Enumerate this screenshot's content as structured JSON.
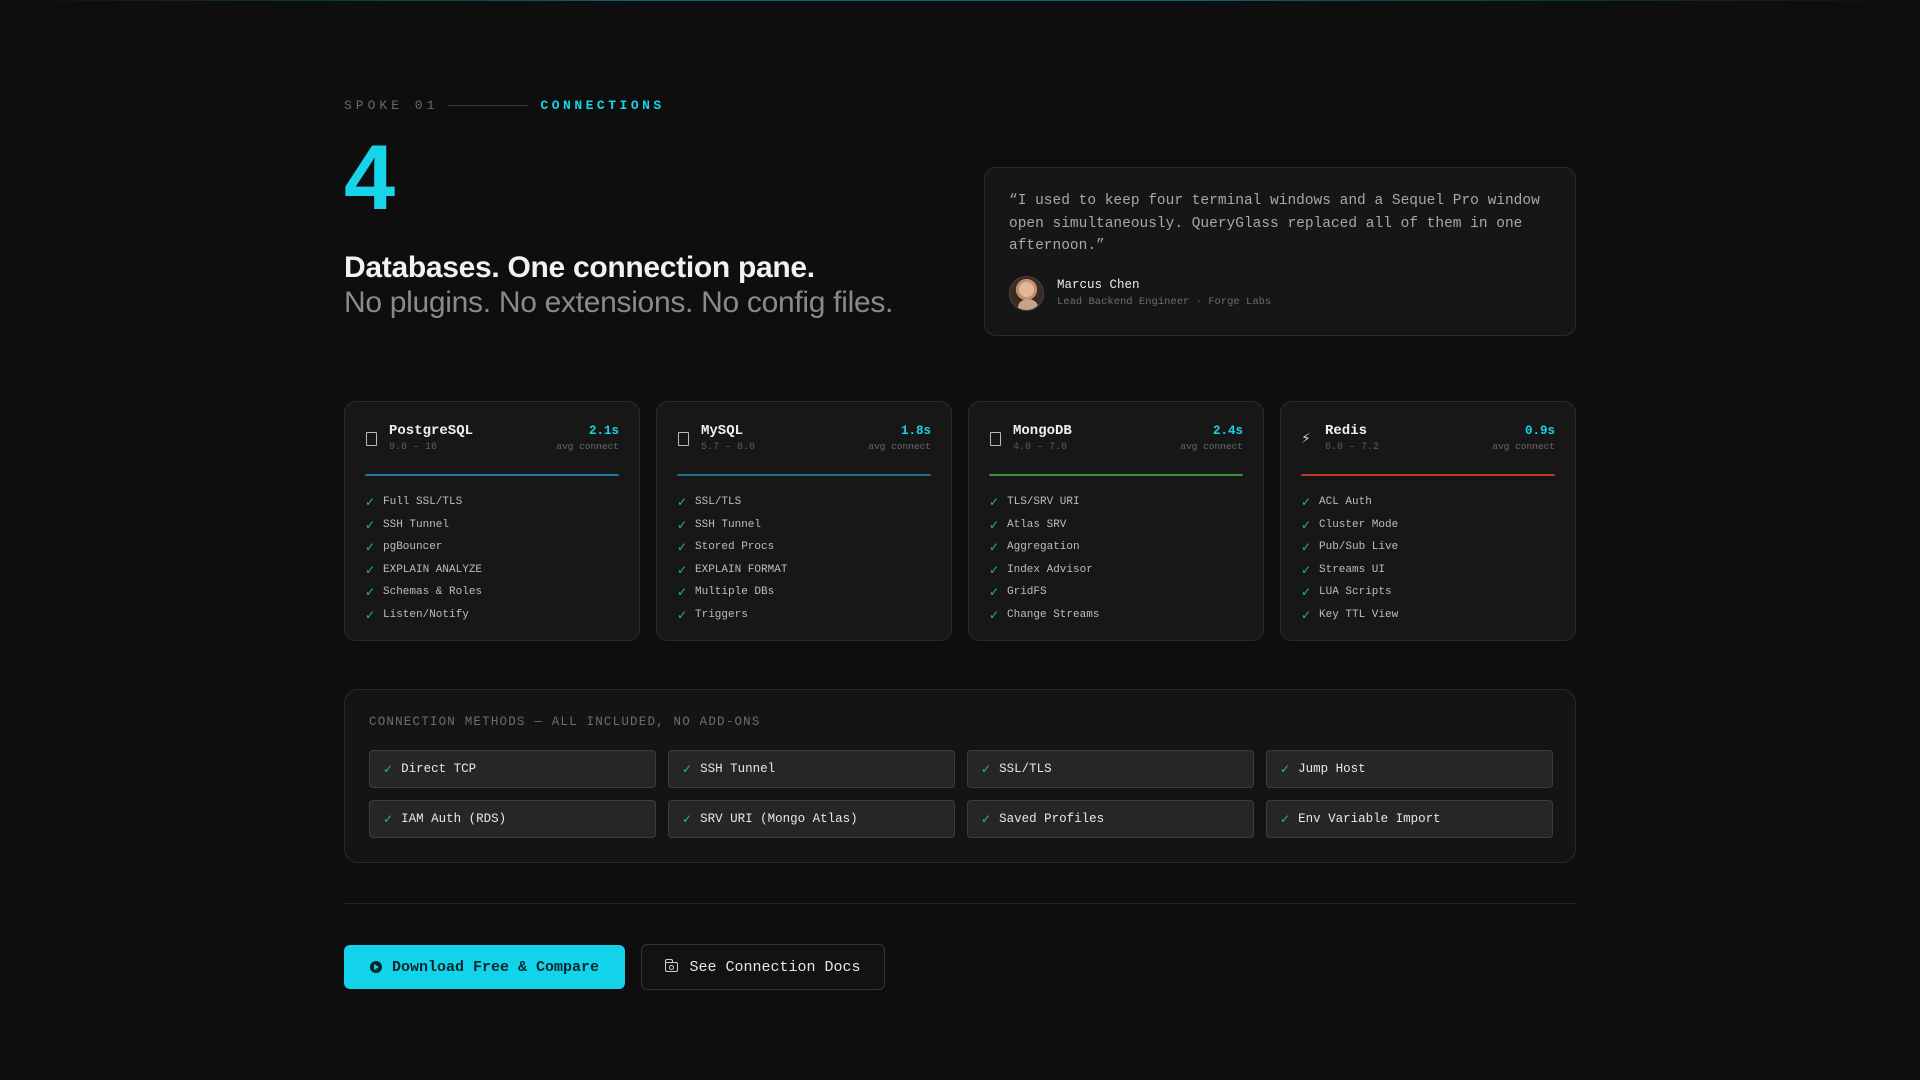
{
  "eyebrow": {
    "spoke": "SPOKE 01",
    "section": "CONNECTIONS"
  },
  "hero": {
    "number": "4",
    "headline": "Databases. One connection pane.",
    "subline": "No plugins. No extensions. No config files."
  },
  "testimonial": {
    "quote": "“I used to keep four terminal windows and a Sequel Pro window open simultaneously. QueryGlass replaced all of them in one afternoon.”",
    "name": "Marcus Chen",
    "role": "Lead Backend Engineer · Forge Labs"
  },
  "databases": [
    {
      "name": "PostgreSQL",
      "versions": "9.6 – 16",
      "icon": "database-icon",
      "avg": "2.1s",
      "avg_label": "avg connect",
      "accent": "#1f7a9a",
      "features": [
        "Full SSL/TLS",
        "SSH Tunnel",
        "pgBouncer",
        "EXPLAIN ANALYZE",
        "Schemas & Roles",
        "Listen/Notify"
      ]
    },
    {
      "name": "MySQL",
      "versions": "5.7 – 8.0",
      "icon": "database-icon",
      "avg": "1.8s",
      "avg_label": "avg connect",
      "accent": "#1f6f8c",
      "features": [
        "SSL/TLS",
        "SSH Tunnel",
        "Stored Procs",
        "EXPLAIN FORMAT",
        "Multiple DBs",
        "Triggers"
      ]
    },
    {
      "name": "MongoDB",
      "versions": "4.0 – 7.0",
      "icon": "database-icon",
      "avg": "2.4s",
      "avg_label": "avg connect",
      "accent": "#3f8f3a",
      "features": [
        "TLS/SRV URI",
        "Atlas SRV",
        "Aggregation",
        "Index Advisor",
        "GridFS",
        "Change Streams"
      ]
    },
    {
      "name": "Redis",
      "versions": "6.0 – 7.2",
      "icon": "lightning-icon",
      "avg": "0.9s",
      "avg_label": "avg connect",
      "accent": "#c0392b",
      "features": [
        "ACL Auth",
        "Cluster Mode",
        "Pub/Sub Live",
        "Streams UI",
        "LUA Scripts",
        "Key TTL View"
      ]
    }
  ],
  "methods": {
    "title": "CONNECTION METHODS — ALL INCLUDED, NO ADD-ONS",
    "items": [
      "Direct TCP",
      "SSH Tunnel",
      "SSL/TLS",
      "Jump Host",
      "IAM Auth (RDS)",
      "SRV URI (Mongo Atlas)",
      "Saved Profiles",
      "Env Variable Import"
    ]
  },
  "cta": {
    "primary": "Download Free & Compare",
    "secondary": "See Connection Docs"
  },
  "colors": {
    "accent": "#18d4e8",
    "check": "#22c55e",
    "background": "#0e0e0e"
  }
}
